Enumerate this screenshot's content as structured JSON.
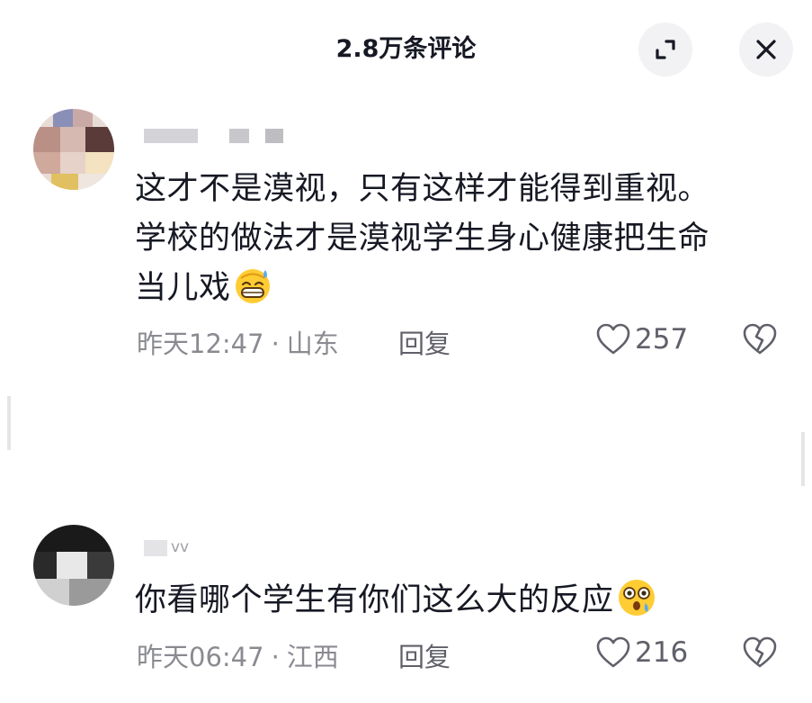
{
  "header": {
    "title": "2.8万条评论",
    "expand_icon": "expand-icon",
    "close_icon": "close-icon"
  },
  "comments": [
    {
      "username": "",
      "text_lines": [
        "这才不是漠视，只有这样才能得到重视。",
        "学校的做法才是漠视学生身心健康把生命",
        "当儿戏"
      ],
      "emoji": "sweat-grin-emoji",
      "time": "昨天12:47",
      "dot": "·",
      "location": "山东",
      "reply_label": "回复",
      "like_count": "257"
    },
    {
      "username": "vv",
      "text_lines": [
        "你看哪个学生有你们这么大的反应"
      ],
      "emoji": "astonished-emoji",
      "time": "昨天06:47",
      "dot": "·",
      "location": "江西",
      "reply_label": "回复",
      "like_count": "216"
    }
  ],
  "colors": {
    "text": "#161823",
    "meta": "#8a8b91",
    "button_bg": "#f2f2f4"
  }
}
